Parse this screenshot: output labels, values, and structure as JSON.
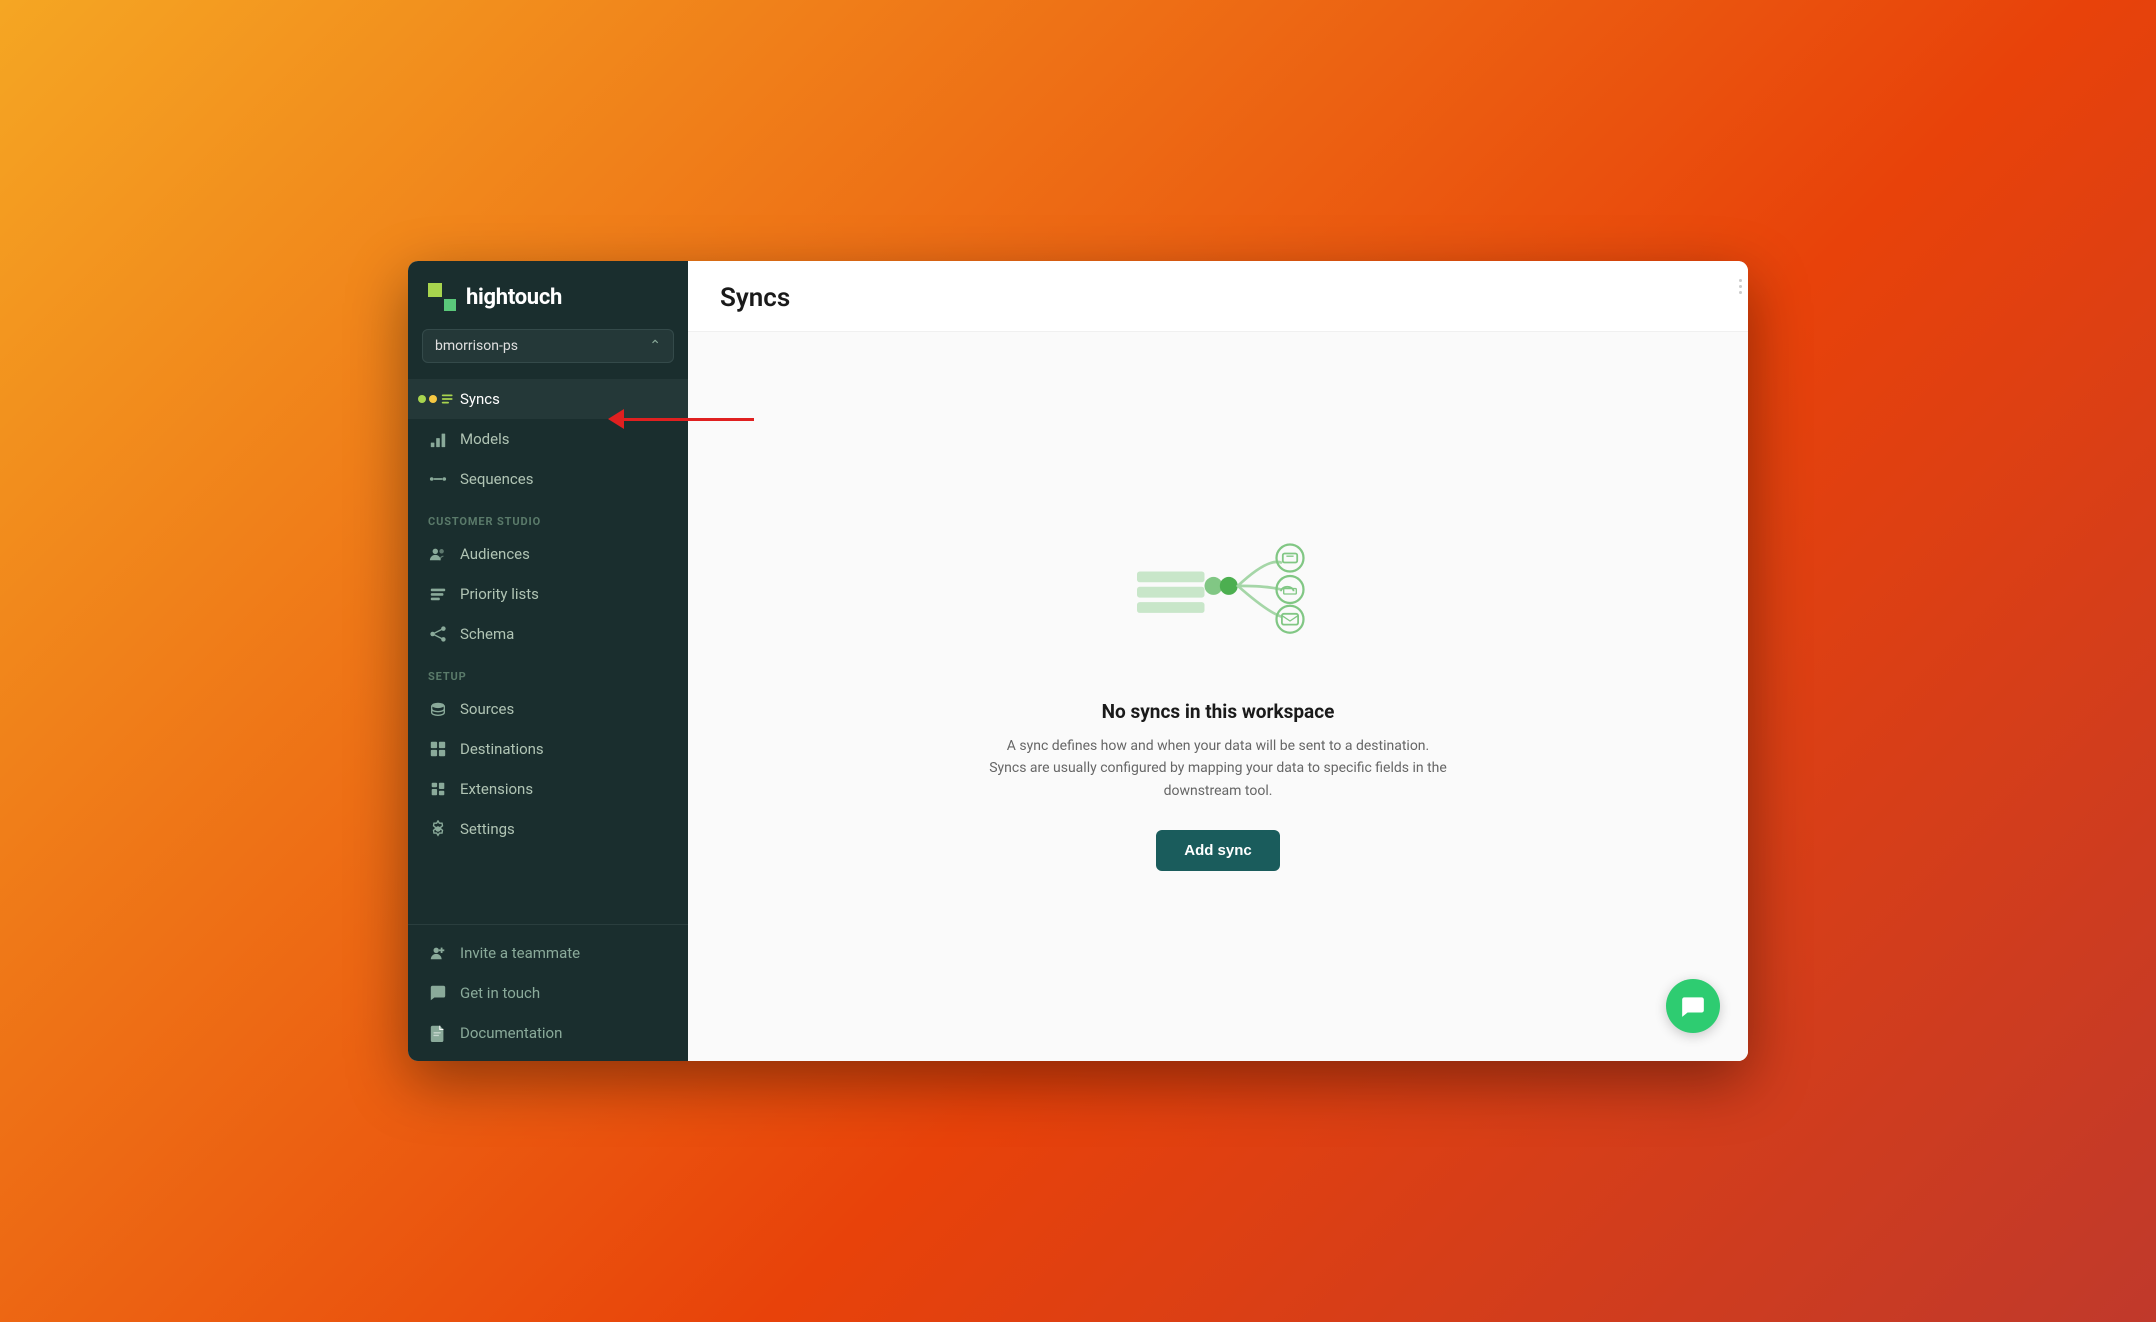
{
  "app": {
    "logo_text": "hightouch",
    "title": "Syncs"
  },
  "sidebar": {
    "workspace": {
      "name": "bmorrison-ps",
      "chevron": "⌃"
    },
    "nav_items": [
      {
        "id": "syncs",
        "label": "Syncs",
        "icon": "syncs-icon",
        "active": true
      },
      {
        "id": "models",
        "label": "Models",
        "icon": "models-icon",
        "active": false
      },
      {
        "id": "sequences",
        "label": "Sequences",
        "icon": "sequences-icon",
        "active": false
      }
    ],
    "customer_studio_label": "CUSTOMER STUDIO",
    "customer_studio_items": [
      {
        "id": "audiences",
        "label": "Audiences",
        "icon": "audiences-icon"
      },
      {
        "id": "priority-lists",
        "label": "Priority lists",
        "icon": "priority-lists-icon"
      },
      {
        "id": "schema",
        "label": "Schema",
        "icon": "schema-icon"
      }
    ],
    "setup_label": "SETUP",
    "setup_items": [
      {
        "id": "sources",
        "label": "Sources",
        "icon": "sources-icon"
      },
      {
        "id": "destinations",
        "label": "Destinations",
        "icon": "destinations-icon"
      },
      {
        "id": "extensions",
        "label": "Extensions",
        "icon": "extensions-icon"
      },
      {
        "id": "settings",
        "label": "Settings",
        "icon": "settings-icon"
      }
    ],
    "bottom_items": [
      {
        "id": "invite-teammate",
        "label": "Invite a teammate",
        "icon": "invite-icon"
      },
      {
        "id": "get-in-touch",
        "label": "Get in touch",
        "icon": "chat-icon"
      },
      {
        "id": "documentation",
        "label": "Documentation",
        "icon": "docs-icon"
      }
    ]
  },
  "main": {
    "title": "Syncs",
    "empty_state": {
      "title": "No syncs in this workspace",
      "description": "A sync defines how and when your data will be sent to a destination. Syncs are usually configured by mapping your data to specific fields in the downstream tool.",
      "add_button": "Add sync"
    }
  }
}
